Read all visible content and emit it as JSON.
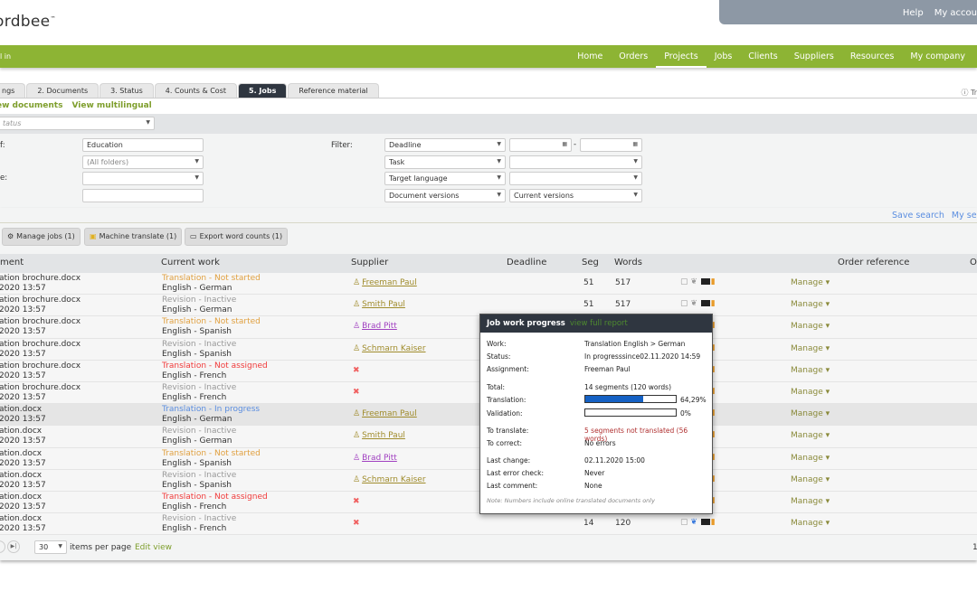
{
  "header": {
    "logo": "ordbee",
    "top_links": [
      "Help",
      "My accou"
    ]
  },
  "nav": {
    "logged_in": "l in",
    "items": [
      "Home",
      "Orders",
      "Projects",
      "Jobs",
      "Clients",
      "Suppliers",
      "Resources",
      "My company"
    ],
    "active": "Projects"
  },
  "tabs": [
    "ngs",
    "2. Documents",
    "3. Status",
    "4. Counts & Cost",
    "5. Jobs",
    "Reference material"
  ],
  "active_tab": "5. Jobs",
  "tab_right": "Tr",
  "sublinks": [
    "ew documents",
    "View multilingual"
  ],
  "status_select": "tatus",
  "form": {
    "labels": [
      "f:",
      "",
      "e:"
    ],
    "project_value": "Education",
    "folders": "(All folders)",
    "type_value": "",
    "extra_value": "",
    "filter_label": "Filter:",
    "filters": [
      {
        "field": "Deadline",
        "value": ""
      },
      {
        "field": "Task",
        "value": ""
      },
      {
        "field": "Target language",
        "value": ""
      },
      {
        "field": "Document versions",
        "value": "Current versions"
      }
    ]
  },
  "search_links": [
    "Save search",
    "My sea"
  ],
  "actions": [
    {
      "label": "Manage jobs (1)",
      "icon": "gear-icon"
    },
    {
      "label": "Machine translate (1)",
      "icon": "machine-icon"
    },
    {
      "label": "Export word counts (1)",
      "icon": "export-icon"
    }
  ],
  "table": {
    "columns": [
      "ment",
      "Current work",
      "Supplier",
      "Deadline",
      "Seg",
      "Words",
      "Order reference",
      "O"
    ],
    "rows": [
      {
        "doc": "ation brochure.docx",
        "date": "2020 13:57",
        "work": "Translation - Not started",
        "status": "notstarted",
        "lang": "English - German",
        "supplier": "Freeman Paul",
        "stype": "gold",
        "seg": "51",
        "words": "517"
      },
      {
        "doc": "ation brochure.docx",
        "date": "2020 13:57",
        "work": "Revision - Inactive",
        "status": "inactive",
        "lang": "English - German",
        "supplier": "Smith Paul",
        "stype": "gold",
        "seg": "51",
        "words": "517"
      },
      {
        "doc": "ation brochure.docx",
        "date": "2020 13:57",
        "work": "Translation - Not started",
        "status": "notstarted",
        "lang": "English - Spanish",
        "supplier": "Brad Pitt",
        "stype": "purple",
        "seg": "",
        "words": ""
      },
      {
        "doc": "ation brochure.docx",
        "date": "2020 13:57",
        "work": "Revision - Inactive",
        "status": "inactive",
        "lang": "English - Spanish",
        "supplier": "Schmarn Kaiser",
        "stype": "gold",
        "seg": "",
        "words": ""
      },
      {
        "doc": "ation brochure.docx",
        "date": "2020 13:57",
        "work": "Translation - Not assigned",
        "status": "notassigned",
        "lang": "English - French",
        "supplier": "",
        "stype": "none",
        "seg": "",
        "words": ""
      },
      {
        "doc": "ation brochure.docx",
        "date": "2020 13:57",
        "work": "Revision - Inactive",
        "status": "inactive",
        "lang": "English - French",
        "supplier": "",
        "stype": "none",
        "seg": "",
        "words": ""
      },
      {
        "doc": "ation.docx",
        "date": "2020 13:57",
        "work": "Translation - In progress",
        "status": "inprogress",
        "lang": "English - German",
        "supplier": "Freeman Paul",
        "stype": "gold",
        "seg": "",
        "words": "",
        "highlight": true
      },
      {
        "doc": "ation.docx",
        "date": "2020 13:57",
        "work": "Revision - Inactive",
        "status": "inactive",
        "lang": "English - German",
        "supplier": "Smith Paul",
        "stype": "gold",
        "seg": "",
        "words": ""
      },
      {
        "doc": "ation.docx",
        "date": "2020 13:57",
        "work": "Translation - Not started",
        "status": "notstarted",
        "lang": "English - Spanish",
        "supplier": "Brad Pitt",
        "stype": "purple",
        "seg": "",
        "words": ""
      },
      {
        "doc": "ation.docx",
        "date": "2020 13:57",
        "work": "Revision - Inactive",
        "status": "inactive",
        "lang": "English - Spanish",
        "supplier": "Schmarn Kaiser",
        "stype": "gold",
        "seg": "",
        "words": ""
      },
      {
        "doc": "ation.docx",
        "date": "2020 13:57",
        "work": "Translation - Not assigned",
        "status": "notassigned",
        "lang": "English - French",
        "supplier": "",
        "stype": "none",
        "seg": "",
        "words": ""
      },
      {
        "doc": "ation.docx",
        "date": "2020 13:57",
        "work": "Revision - Inactive",
        "status": "inactive",
        "lang": "English - French",
        "supplier": "",
        "stype": "none",
        "seg": "14",
        "words": "120"
      }
    ],
    "manage_label": "Manage"
  },
  "status_colors": {
    "notstarted": "#e0a040",
    "inactive": "#999999",
    "notassigned": "#f03a3a",
    "inprogress": "#5b8ee0"
  },
  "pager": {
    "per_page": "30",
    "per_page_label": "items per page",
    "edit_view": "Edit view",
    "page": "1"
  },
  "popup": {
    "title": "Job work progress",
    "link": "view full report",
    "fields": [
      {
        "label": "Work:",
        "value": "Translation English > German"
      },
      {
        "label": "Status:",
        "value": "In progresssince02.11.2020 14:59"
      },
      {
        "label": "Assignment:",
        "value": "Freeman Paul"
      },
      {
        "label": "Total:",
        "value": "14 segments (120 words)"
      },
      {
        "label": "Translation:",
        "value": "64,29%",
        "progress": 64.29
      },
      {
        "label": "Validation:",
        "value": "0%",
        "progress": 0
      },
      {
        "label": "To translate:",
        "value": "5 segments not translated (56 words)",
        "color": "#b03030"
      },
      {
        "label": "To correct:",
        "value": "No errors"
      },
      {
        "label": "Last change:",
        "value": "02.11.2020 15:00"
      },
      {
        "label": "Last error check:",
        "value": "Never"
      },
      {
        "label": "Last comment:",
        "value": "None"
      }
    ],
    "note": "Note: Numbers include online translated documents only"
  }
}
